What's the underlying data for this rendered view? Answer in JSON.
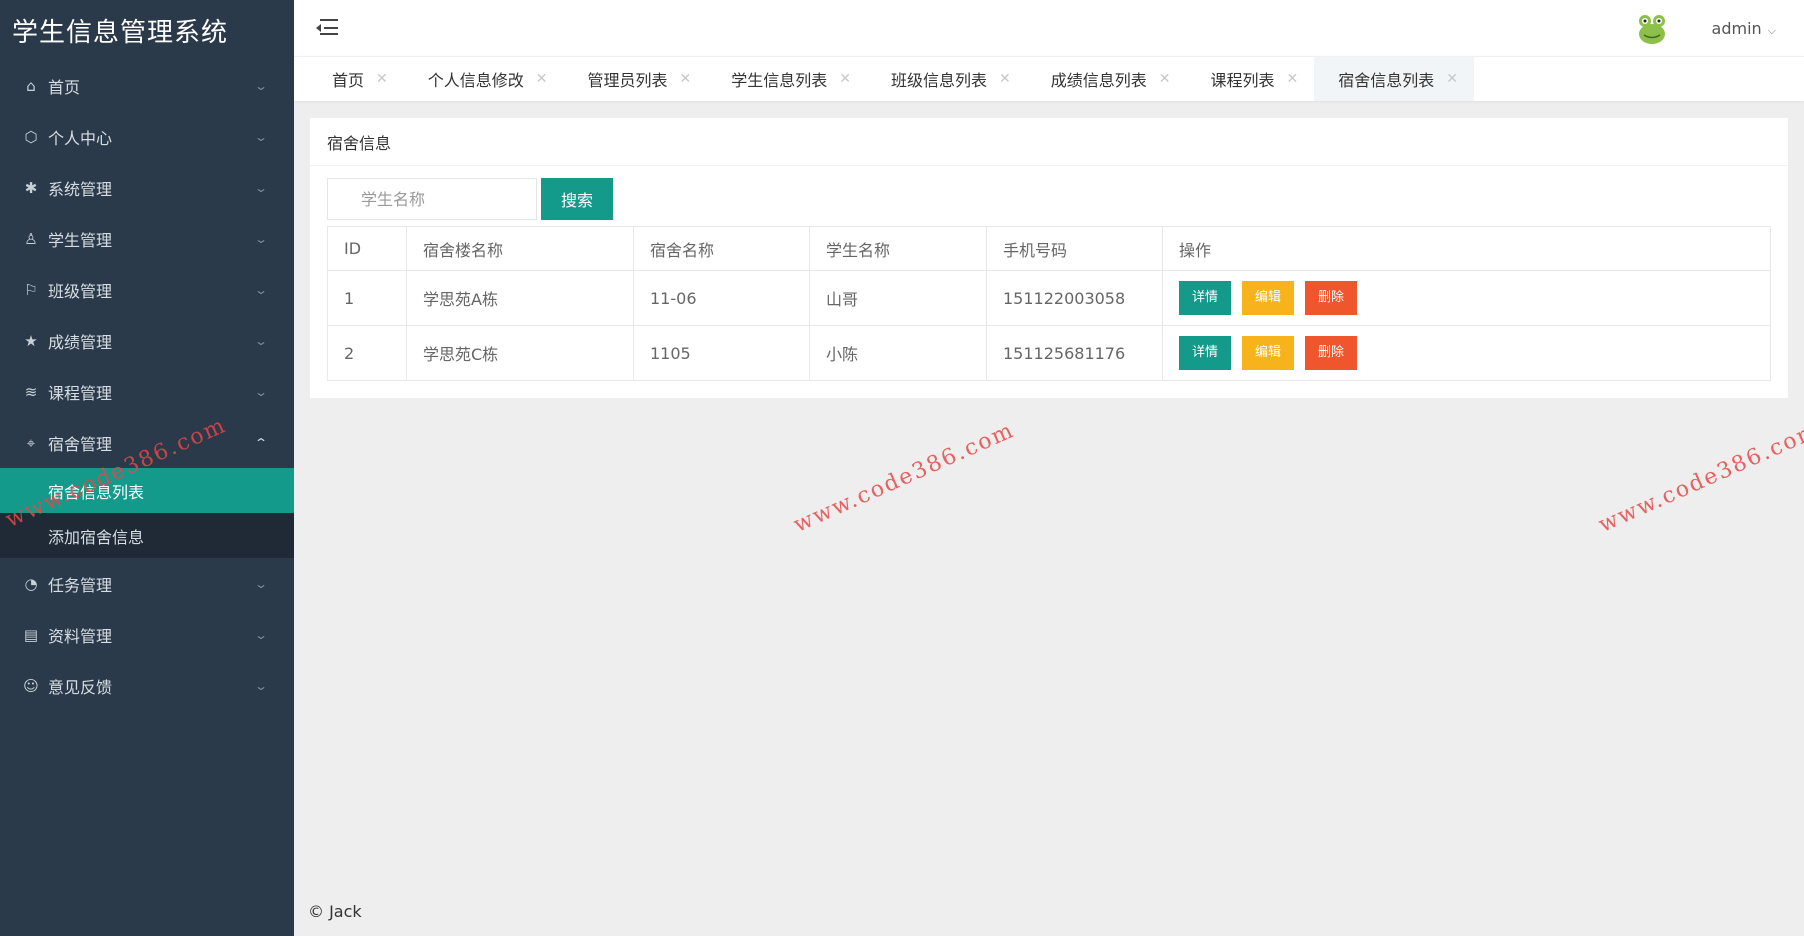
{
  "app": {
    "title": "学生信息管理系统"
  },
  "sidebar": {
    "items": [
      {
        "label": "首页",
        "icon": "home-icon"
      },
      {
        "label": "个人中心",
        "icon": "cube-icon"
      },
      {
        "label": "系统管理",
        "icon": "gear-icon"
      },
      {
        "label": "学生管理",
        "icon": "user-icon"
      },
      {
        "label": "班级管理",
        "icon": "flag-icon"
      },
      {
        "label": "成绩管理",
        "icon": "star-icon"
      },
      {
        "label": "课程管理",
        "icon": "layers-icon"
      },
      {
        "label": "宿舍管理",
        "icon": "location-icon",
        "expanded": true
      },
      {
        "label": "任务管理",
        "icon": "gauge-icon"
      },
      {
        "label": "资料管理",
        "icon": "document-icon"
      },
      {
        "label": "意见反馈",
        "icon": "feedback-icon"
      }
    ],
    "sub_items": [
      {
        "label": "宿舍信息列表",
        "active": true
      },
      {
        "label": "添加宿舍信息",
        "active": false
      }
    ]
  },
  "header": {
    "user_name": "admin"
  },
  "tabs": [
    {
      "label": "首页"
    },
    {
      "label": "个人信息修改"
    },
    {
      "label": "管理员列表"
    },
    {
      "label": "学生信息列表"
    },
    {
      "label": "班级信息列表"
    },
    {
      "label": "成绩信息列表"
    },
    {
      "label": "课程列表"
    },
    {
      "label": "宿舍信息列表",
      "active": true
    }
  ],
  "panel": {
    "title": "宿舍信息",
    "search": {
      "placeholder": "学生名称",
      "button_label": "搜索"
    },
    "table": {
      "headers": [
        "ID",
        "宿舍楼名称",
        "宿舍名称",
        "学生名称",
        "手机号码",
        "操作"
      ],
      "rows": [
        {
          "id": "1",
          "building": "学思苑A栋",
          "room": "11-06",
          "student": "山哥",
          "phone": "151122003058"
        },
        {
          "id": "2",
          "building": "学思苑C栋",
          "room": "1105",
          "student": "小陈",
          "phone": "151125681176"
        }
      ],
      "actions": {
        "detail": "详情",
        "edit": "编辑",
        "delete": "删除"
      }
    }
  },
  "footer": {
    "text": "© Jack"
  },
  "watermark": {
    "text": "www.code386.com"
  },
  "colors": {
    "sidebar_bg": "#2b3a4a",
    "accent": "#139a8b",
    "edit": "#f6b31c",
    "delete": "#f0562e"
  }
}
